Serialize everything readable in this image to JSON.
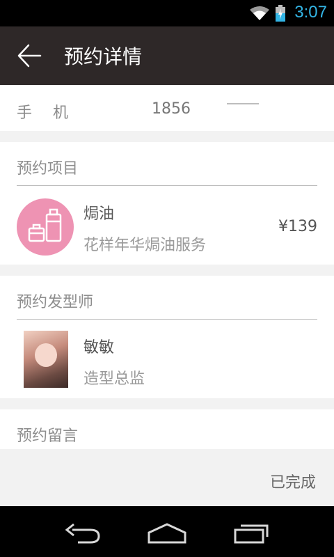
{
  "status_bar": {
    "time": "3:07"
  },
  "app_bar": {
    "title": "预约详情"
  },
  "phone": {
    "label": "手机",
    "value": "1856"
  },
  "service": {
    "section_title": "预约项目",
    "name": "焗油",
    "description": "花样年华焗油服务",
    "price": "¥139",
    "icon_color": "#ee93b3"
  },
  "stylist": {
    "section_title": "预约发型师",
    "name": "敏敏",
    "role": "造型总监"
  },
  "message": {
    "section_title": "预约留言"
  },
  "footer": {
    "status": "已完成"
  }
}
